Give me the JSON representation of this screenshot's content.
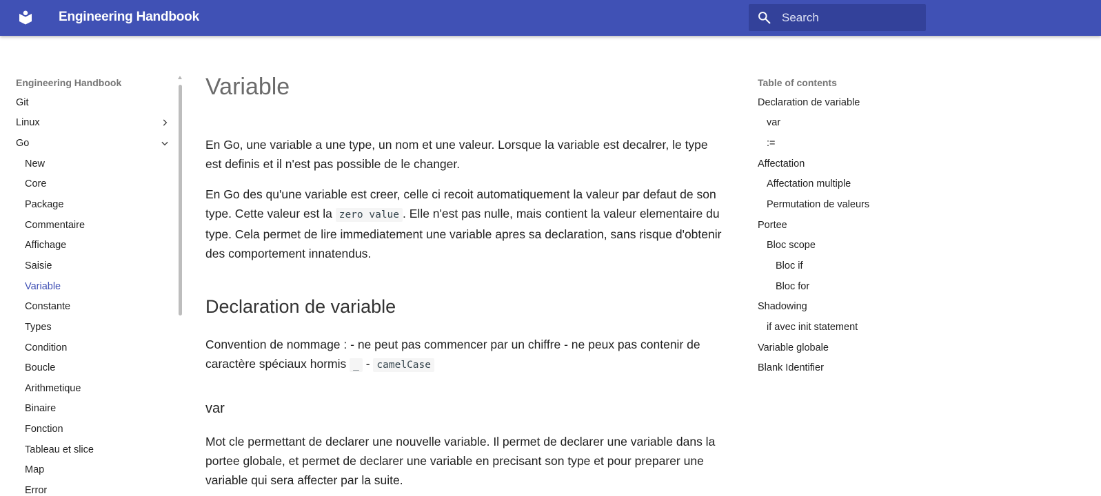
{
  "header": {
    "site_title": "Engineering Handbook",
    "search_placeholder": "Search"
  },
  "nav": {
    "title": "Engineering Handbook",
    "items": [
      {
        "label": "Git"
      },
      {
        "label": "Linux",
        "chevron": "chevron-right"
      },
      {
        "label": "Go",
        "chevron": "chevron-down"
      }
    ],
    "sub_items": [
      {
        "label": "New"
      },
      {
        "label": "Core"
      },
      {
        "label": "Package"
      },
      {
        "label": "Commentaire"
      },
      {
        "label": "Affichage"
      },
      {
        "label": "Saisie"
      },
      {
        "label": "Variable",
        "active": true
      },
      {
        "label": "Constante"
      },
      {
        "label": "Types"
      },
      {
        "label": "Condition"
      },
      {
        "label": "Boucle"
      },
      {
        "label": "Arithmetique"
      },
      {
        "label": "Binaire"
      },
      {
        "label": "Fonction"
      },
      {
        "label": "Tableau et slice"
      },
      {
        "label": "Map"
      },
      {
        "label": "Error"
      }
    ]
  },
  "content": {
    "title": "Variable",
    "intro_p1": "En Go, une variable a une type, un nom et une valeur. Lorsque la variable est decalrer, le type est definis et il n'est pas possible de le changer.",
    "intro_p2_a": "En Go des qu'une variable est creer, celle ci recoit automatiquement la valeur par defaut de son type. Cette valeur est la ",
    "intro_p2_code": "zero value",
    "intro_p2_b": ". Elle n'est pas nulle, mais contient la valeur elementaire du type. Cela permet de lire immediatement une variable apres sa declaration, sans risque d'obtenir des comportement innatendus.",
    "h2_declaration": "Declaration de variable",
    "convention_a": "Convention de nommage : - ne peut pas commencer par un chiffre - ne peux pas contenir de caractère spéciaux hormis ",
    "convention_code1": "_",
    "convention_sep": " - ",
    "convention_code2": "camelCase",
    "h3_var": "var",
    "var_p": "Mot cle permettant de declarer une nouvelle variable. Il permet de declarer une variable dans la portee globale, et permet de declarer une variable en precisant son type et pour preparer une variable qui sera affecter par la suite."
  },
  "toc": {
    "title": "Table of contents",
    "items": [
      {
        "label": "Declaration de variable",
        "level": 0
      },
      {
        "label": "var",
        "level": 1
      },
      {
        "label": ":=",
        "level": 1
      },
      {
        "label": "Affectation",
        "level": 0
      },
      {
        "label": "Affectation multiple",
        "level": 1
      },
      {
        "label": "Permutation de valeurs",
        "level": 1
      },
      {
        "label": "Portee",
        "level": 0
      },
      {
        "label": "Bloc scope",
        "level": 1
      },
      {
        "label": "Bloc if",
        "level": 2
      },
      {
        "label": "Bloc for",
        "level": 2
      },
      {
        "label": "Shadowing",
        "level": 0
      },
      {
        "label": "if avec init statement",
        "level": 1
      },
      {
        "label": "Variable globale",
        "level": 0
      },
      {
        "label": "Blank Identifier",
        "level": 0
      }
    ]
  },
  "colors": {
    "header_bg": "#4051b5",
    "search_bg": "#33419a",
    "active_link": "#4051b5"
  }
}
